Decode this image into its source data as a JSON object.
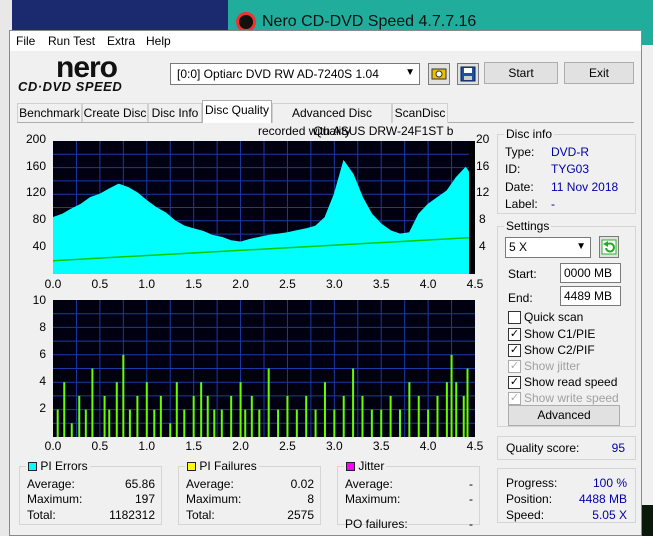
{
  "bg_window": {
    "title": "Nero CD-DVD Speed 4.7.7.16"
  },
  "menu": [
    "File",
    "Run Test",
    "Extra",
    "Help"
  ],
  "logo": {
    "word": "nero",
    "sub": "CD·DVD SPEED"
  },
  "toolbar": {
    "drive": "[0:0]  Optiarc DVD RW AD-7240S 1.04",
    "start_label": "Start",
    "exit_label": "Exit"
  },
  "tabs": [
    "Benchmark",
    "Create Disc",
    "Disc Info",
    "Disc Quality",
    "Advanced Disc Quality",
    "ScanDisc"
  ],
  "active_tab": "Disc Quality",
  "recorded_with": "recorded with ASUS     DRW-24F1ST   b",
  "chart_data": [
    {
      "type": "area",
      "y_left_ticks": [
        "200",
        "160",
        "120",
        "80",
        "40"
      ],
      "y_right_ticks": [
        "20",
        "16",
        "12",
        "8",
        "4"
      ],
      "x_ticks": [
        "0.0",
        "0.5",
        "1.0",
        "1.5",
        "2.0",
        "2.5",
        "3.0",
        "3.5",
        "4.0",
        "4.5"
      ],
      "xlim": [
        0,
        4.5
      ],
      "ylim": [
        0,
        200
      ],
      "y2lim": [
        0,
        20
      ],
      "series": [
        {
          "color": "#00ffff",
          "x": [
            0.0,
            0.1,
            0.2,
            0.3,
            0.4,
            0.5,
            0.6,
            0.7,
            0.8,
            0.9,
            1.0,
            1.1,
            1.2,
            1.3,
            1.4,
            1.5,
            1.6,
            1.7,
            1.8,
            1.9,
            2.0,
            2.1,
            2.2,
            2.3,
            2.4,
            2.5,
            2.6,
            2.7,
            2.8,
            2.9,
            3.0,
            3.1,
            3.2,
            3.3,
            3.4,
            3.5,
            3.6,
            3.7,
            3.8,
            3.9,
            4.0,
            4.1,
            4.2,
            4.3,
            4.4,
            4.45
          ],
          "y": [
            85,
            90,
            98,
            105,
            115,
            120,
            128,
            135,
            130,
            122,
            110,
            100,
            92,
            80,
            72,
            68,
            64,
            58,
            55,
            50,
            48,
            52,
            55,
            58,
            60,
            62,
            65,
            68,
            72,
            85,
            120,
            170,
            150,
            115,
            90,
            75,
            65,
            60,
            62,
            90,
            105,
            115,
            125,
            145,
            160,
            150
          ]
        },
        {
          "color": "#00cc00",
          "x": [
            0.0,
            4.5
          ],
          "y": [
            2.0,
            5.5
          ]
        }
      ]
    },
    {
      "type": "bar",
      "y_ticks": [
        "10",
        "8",
        "6",
        "4",
        "2"
      ],
      "x_ticks": [
        "0.0",
        "0.5",
        "1.0",
        "1.5",
        "2.0",
        "2.5",
        "3.0",
        "3.5",
        "4.0",
        "4.5"
      ],
      "xlim": [
        0,
        4.5
      ],
      "ylim": [
        0,
        10
      ],
      "series": [
        {
          "color": "#66ff00",
          "x": [
            0.05,
            0.12,
            0.2,
            0.28,
            0.35,
            0.42,
            0.55,
            0.6,
            0.68,
            0.75,
            0.82,
            0.9,
            1.0,
            1.08,
            1.15,
            1.25,
            1.32,
            1.4,
            1.5,
            1.58,
            1.65,
            1.72,
            1.8,
            1.9,
            2.0,
            2.05,
            2.12,
            2.2,
            2.3,
            2.4,
            2.5,
            2.6,
            2.7,
            2.8,
            2.9,
            3.0,
            3.1,
            3.2,
            3.3,
            3.4,
            3.5,
            3.6,
            3.7,
            3.8,
            3.9,
            4.0,
            4.1,
            4.2,
            4.25,
            4.3,
            4.38,
            4.42
          ],
          "y": [
            2,
            4,
            1,
            3,
            2,
            5,
            3,
            2,
            4,
            6,
            2,
            3,
            4,
            2,
            3,
            1,
            4,
            2,
            3,
            4,
            3,
            2,
            2,
            3,
            4,
            2,
            3,
            2,
            5,
            2,
            3,
            2,
            3,
            2,
            4,
            2,
            3,
            5,
            3,
            2,
            2,
            3,
            2,
            4,
            3,
            2,
            3,
            4,
            6,
            4,
            3,
            5
          ]
        }
      ]
    }
  ],
  "disc_info": {
    "title": "Disc info",
    "type_k": "Type:",
    "type_v": "DVD-R",
    "id_k": "ID:",
    "id_v": "TYG03",
    "date_k": "Date:",
    "date_v": "11 Nov 2018",
    "label_k": "Label:",
    "label_v": "-"
  },
  "settings": {
    "title": "Settings",
    "speed": "5 X",
    "start_k": "Start:",
    "start_v": "0000 MB",
    "end_k": "End:",
    "end_v": "4489 MB",
    "quick_scan": "Quick scan",
    "show_c1": "Show C1/PIE",
    "show_c2": "Show C2/PIF",
    "show_jitter": "Show jitter",
    "show_read": "Show read speed",
    "show_write": "Show write speed",
    "advanced": "Advanced"
  },
  "quality": {
    "label": "Quality score:",
    "value": "95"
  },
  "progress": {
    "progress_k": "Progress:",
    "progress_v": "100 %",
    "position_k": "Position:",
    "position_v": "4488 MB",
    "speed_k": "Speed:",
    "speed_v": "5.05 X"
  },
  "pi_errors": {
    "title": "PI Errors",
    "color": "#00ffff",
    "avg_k": "Average:",
    "avg_v": "65.86",
    "max_k": "Maximum:",
    "max_v": "197",
    "tot_k": "Total:",
    "tot_v": "1182312"
  },
  "pi_failures": {
    "title": "PI Failures",
    "color": "#ffff00",
    "avg_k": "Average:",
    "avg_v": "0.02",
    "max_k": "Maximum:",
    "max_v": "8",
    "tot_k": "Total:",
    "tot_v": "2575"
  },
  "jitter": {
    "title": "Jitter",
    "color": "#ff00ff",
    "avg_k": "Average:",
    "avg_v": "-",
    "max_k": "Maximum:",
    "max_v": "-",
    "pof_k": "PO failures:",
    "pof_v": "-"
  }
}
